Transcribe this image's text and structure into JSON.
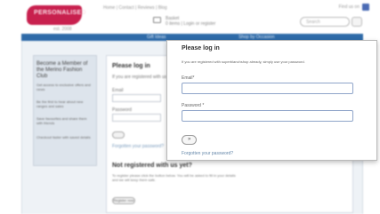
{
  "header": {
    "top_links": "Home  |  Contact  |  Reviews  |  Blog",
    "top_right": "Find us on",
    "cart_line1": "Basket",
    "cart_line2": "0 items  |  Login or register",
    "search_placeholder": "Search",
    "site_tagline": "est. 2008"
  },
  "nav": {
    "items": [
      "Gift Ideas",
      "Shop by Occasion"
    ]
  },
  "sidebar": {
    "title": "Become a Member of the Merino Fashion Club",
    "paragraphs": [
      "Get access to exclusive offers and news",
      "Be the first to hear about new ranges and sales",
      "Save favourites and share them with friends",
      "Checkout faster with saved details"
    ]
  },
  "main_panel": {
    "heading": "Please log in",
    "intro": "If you are registered with us please log in.",
    "email_label": "Email",
    "password_label": "Password",
    "forgot_link": "Forgotten your password?",
    "register_heading": "Not registered with us yet?",
    "register_text": "To register please click the button below. You will be asked to fill in your details and we will keep them safe.",
    "register_button": "Register now"
  },
  "popup": {
    "title": "Please log in",
    "intro": "If you are registered with superblanchshop already, simply use your password.",
    "email_label": "Email*",
    "password_label": "Password *",
    "submit_arrow": "»",
    "forgot_link": "Forgotten your password?"
  },
  "colors": {
    "brand_logo": "#c8204e",
    "nav_bar": "#2e6aa8",
    "input_border": "#8fa5c9"
  }
}
